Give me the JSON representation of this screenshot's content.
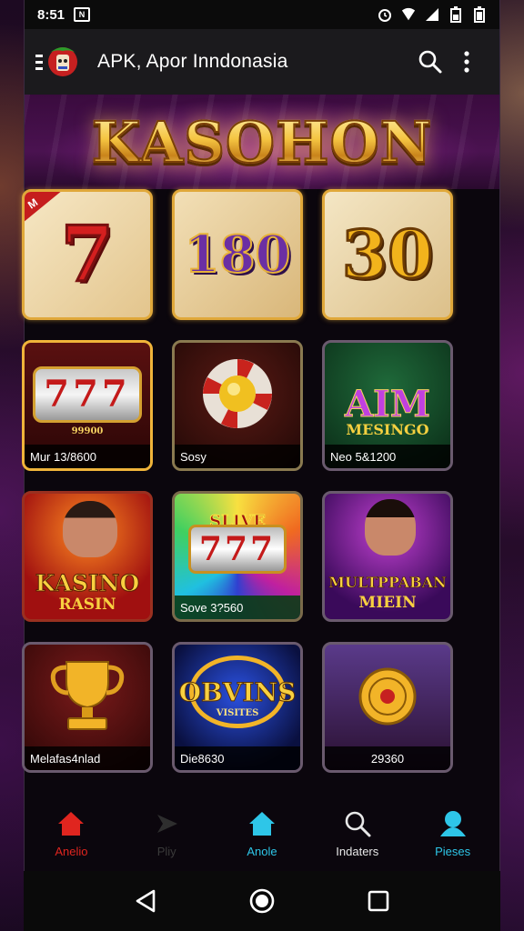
{
  "status_bar": {
    "time": "8:51",
    "left_icon": "n-icon"
  },
  "app_bar": {
    "title": "APK, Apor Inndonasia",
    "search_icon": "search-icon",
    "menu_icon": "more-vert-icon"
  },
  "hero": {
    "title": "KASOHON"
  },
  "tiles": [
    {
      "art": "7",
      "corner_label": "M",
      "caption": ""
    },
    {
      "art": "180",
      "caption": ""
    },
    {
      "art": "30",
      "caption": ""
    },
    {
      "art": "777",
      "art_sub": "99900",
      "caption": "Mur   13/8600"
    },
    {
      "art": "chip",
      "caption": "Sosy"
    },
    {
      "art": "AIM",
      "art_sub": "MESINGO",
      "caption": "Neo   5&1200"
    },
    {
      "art": "KASINO",
      "art_sub": "RASIN",
      "caption": ""
    },
    {
      "art": "777",
      "art_top": "SLIVE",
      "caption": "Sove  3?560"
    },
    {
      "art": "MULTPPABAN",
      "art_sub": "MIEIN",
      "caption": ""
    },
    {
      "art": "trophy",
      "caption": "Melafas4nlad"
    },
    {
      "art": "OBVINS",
      "art_sub": "VISITES",
      "caption": "Die8630"
    },
    {
      "art": "coins",
      "caption": "29360"
    }
  ],
  "bottom_nav": [
    {
      "label": "Anelio",
      "icon": "home-icon",
      "color": "#e0251f"
    },
    {
      "label": "Pliy",
      "icon": "play-icon",
      "color": "#3a3a3a"
    },
    {
      "label": "Anole",
      "icon": "home-icon",
      "color": "#2ec6e8"
    },
    {
      "label": "Indaters",
      "icon": "search-icon",
      "color": "#e8e8e8"
    },
    {
      "label": "Pieses",
      "icon": "people-icon",
      "color": "#2ec6e8"
    }
  ],
  "system_nav": [
    "back-icon",
    "home-circle-icon",
    "recents-icon"
  ]
}
